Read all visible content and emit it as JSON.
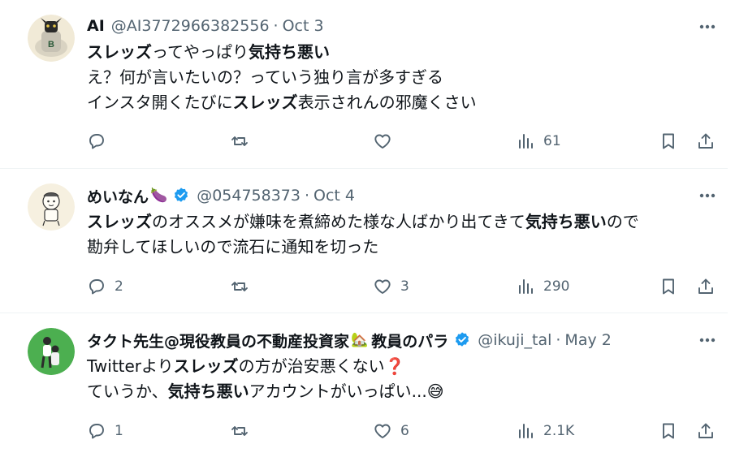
{
  "tweets": [
    {
      "name": "AI",
      "name_emoji": "",
      "verified": false,
      "handle": "@AI3772966382556",
      "date": "Oct 3",
      "lines": [
        [
          {
            "t": "スレッズ",
            "b": true
          },
          {
            "t": "ってやっぱり",
            "b": false
          },
          {
            "t": "気持ち悪い",
            "b": true
          }
        ],
        [
          {
            "t": "え？何が言いたいの？っていう独り言が多すぎる",
            "b": false
          }
        ],
        [
          {
            "t": "インスタ開くたびに",
            "b": false
          },
          {
            "t": "スレッズ",
            "b": true
          },
          {
            "t": "表示されんの邪魔くさい",
            "b": false
          }
        ]
      ],
      "replies": "",
      "retweets": "",
      "likes": "",
      "views": "61"
    },
    {
      "name": "めいなん",
      "name_emoji": "🍆",
      "verified": true,
      "handle": "@054758373",
      "date": "Oct 4",
      "lines": [
        [
          {
            "t": "スレッズ",
            "b": true
          },
          {
            "t": "のオススメが嫌味を煮締めた様な人ばかり出てきて",
            "b": false
          },
          {
            "t": "気持ち悪い",
            "b": true
          },
          {
            "t": "ので",
            "b": false
          }
        ],
        [
          {
            "t": "勘弁してほしいので流石に通知を切った",
            "b": false
          }
        ]
      ],
      "replies": "2",
      "retweets": "",
      "likes": "3",
      "views": "290"
    },
    {
      "name": "タクト先生@現役教員の不動産投資家",
      "name_emoji": "🏡",
      "name_suffix": "教員のパラ",
      "verified": true,
      "handle": "@ikuji_tal",
      "date": "May 2",
      "lines": [
        [
          {
            "t": "Twitterより",
            "b": false
          },
          {
            "t": "スレッズ",
            "b": true
          },
          {
            "t": "の方が治安悪くない",
            "b": false
          },
          {
            "t": "❓",
            "b": false,
            "emoji": true
          }
        ],
        [
          {
            "t": "ていうか、",
            "b": false
          },
          {
            "t": "気持ち悪い",
            "b": true
          },
          {
            "t": "アカウントがいっぱい...",
            "b": false
          },
          {
            "t": "😅",
            "b": false,
            "emoji": true
          }
        ]
      ],
      "replies": "1",
      "retweets": "",
      "likes": "6",
      "views": "2.1K"
    }
  ],
  "colors": {
    "text": "#0f1419",
    "secondary": "#536471",
    "verified": "#1d9bf0",
    "border": "#eff3f4"
  },
  "icons": {
    "reply": "reply-icon",
    "retweet": "retweet-icon",
    "like": "like-icon",
    "views": "views-icon",
    "bookmark": "bookmark-icon",
    "share": "share-icon",
    "more": "more-icon"
  }
}
